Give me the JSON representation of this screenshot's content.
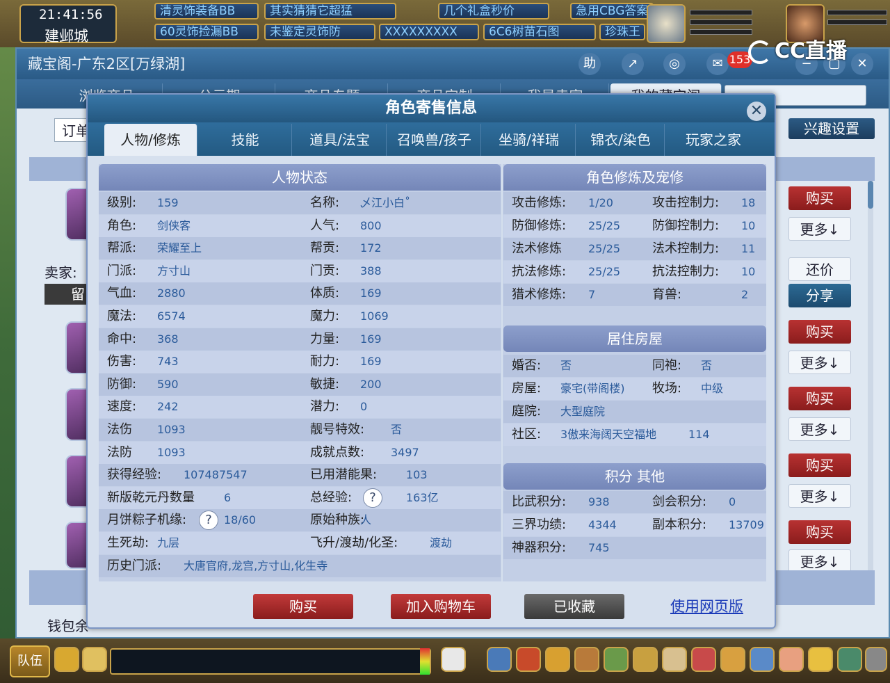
{
  "game": {
    "clock": "21:41:56",
    "city": "建邺城",
    "top_tabs": [
      "清灵饰装备BB",
      "其实猜猜它超猛",
      "几个礼盒秒价",
      "急用CBG答案",
      "60灵饰捡漏BB",
      "未鉴定灵饰防",
      "XXXXXXXXX",
      "6C6树苗石图",
      "珍珠王"
    ],
    "watermark": "CC直播",
    "team_label": "队伍"
  },
  "window": {
    "title": "藏宝阁-广东2区[万绿湖]",
    "tabs": [
      "浏览商品",
      "公示期",
      "商品专题",
      "商品定制",
      "我是卖家",
      "我的藏宝阁"
    ],
    "toolbar_help": "助",
    "message_count": "153",
    "order_label": "订单",
    "interest_label": "兴趣设置",
    "seller_label": "卖家:",
    "message_button": "留",
    "wallet_label": "钱包余",
    "right_buttons": {
      "buy": "购买",
      "more": "更多↓",
      "bargain": "还价",
      "share": "分享"
    }
  },
  "modal": {
    "title": "角色寄售信息",
    "tabs": [
      "人物/修炼",
      "技能",
      "道具/法宝",
      "召唤兽/孩子",
      "坐骑/祥瑞",
      "锦衣/染色",
      "玩家之家"
    ],
    "sections": {
      "status": "人物状态",
      "cultivation": "角色修炼及宠修",
      "house": "居住房屋",
      "score": "积分 其他"
    },
    "status_rows": [
      {
        "l1": "级别:",
        "v1": "159",
        "l2": "名称:",
        "v2": "乄江小白˚"
      },
      {
        "l1": "角色:",
        "v1": "剑侠客",
        "l2": "人气:",
        "v2": "800"
      },
      {
        "l1": "帮派:",
        "v1": "荣耀至上",
        "l2": "帮贡:",
        "v2": "172"
      },
      {
        "l1": "门派:",
        "v1": "方寸山",
        "l2": "门贡:",
        "v2": "388"
      },
      {
        "l1": "气血:",
        "v1": "2880",
        "l2": "体质:",
        "v2": "169"
      },
      {
        "l1": "魔法:",
        "v1": "6574",
        "l2": "魔力:",
        "v2": "1069"
      },
      {
        "l1": "命中:",
        "v1": "368",
        "l2": "力量:",
        "v2": "169"
      },
      {
        "l1": "伤害:",
        "v1": "743",
        "l2": "耐力:",
        "v2": "169"
      },
      {
        "l1": "防御:",
        "v1": "590",
        "l2": "敏捷:",
        "v2": "200"
      },
      {
        "l1": "速度:",
        "v1": "242",
        "l2": "潜力:",
        "v2": "0"
      },
      {
        "l1": "法伤",
        "v1": "1093",
        "l2": "靓号特效:",
        "v2": "否"
      },
      {
        "l1": "法防",
        "v1": "1093",
        "l2": "成就点数:",
        "v2": "3497"
      },
      {
        "l1": "获得经验:",
        "v1": "107487547",
        "l2": "已用潜能果:",
        "v2": "103"
      },
      {
        "l1": "新版乾元丹数量",
        "v1": "6",
        "l2": "总经验:",
        "v2": "163亿"
      },
      {
        "l1": "月饼粽子机缘:",
        "v1": "18/60",
        "l2": "原始种族:",
        "v2": "人"
      },
      {
        "l1": "生死劫:",
        "v1": "九层",
        "l2": "飞升/渡劫/化圣:",
        "v2": "渡劫"
      },
      {
        "l1": "历史门派:",
        "v1": "大唐官府,龙宫,方寸山,化生寺",
        "l2": "",
        "v2": ""
      }
    ],
    "cultivation_rows": [
      {
        "l1": "攻击修炼:",
        "v1": "1/20",
        "l2": "攻击控制力:",
        "v2": "18"
      },
      {
        "l1": "防御修炼:",
        "v1": "25/25",
        "l2": "防御控制力:",
        "v2": "10"
      },
      {
        "l1": "法术修炼",
        "v1": "25/25",
        "l2": "法术控制力:",
        "v2": "11"
      },
      {
        "l1": "抗法修炼:",
        "v1": "25/25",
        "l2": "抗法控制力:",
        "v2": "10"
      },
      {
        "l1": "猎术修炼:",
        "v1": "7",
        "l2": "育兽:",
        "v2": "2"
      }
    ],
    "house_rows": [
      {
        "l1": "婚否:",
        "v1": "否",
        "l2": "同袍:",
        "v2": "否"
      },
      {
        "l1": "房屋:",
        "v1": "豪宅(带阁楼)",
        "l2": "牧场:",
        "v2": "中级"
      },
      {
        "l1": "庭院:",
        "v1": "大型庭院",
        "l2": "",
        "v2": ""
      },
      {
        "l1": "社区:",
        "v1": "3傲来海阔天空福地",
        "l2": "",
        "v2": "114"
      }
    ],
    "score_rows": [
      {
        "l1": "比武积分:",
        "v1": "938",
        "l2": "剑会积分:",
        "v2": "0"
      },
      {
        "l1": "三界功绩:",
        "v1": "4344",
        "l2": "副本积分:",
        "v2": "13709"
      },
      {
        "l1": "神器积分:",
        "v1": "745",
        "l2": "",
        "v2": ""
      }
    ],
    "buttons": {
      "buy": "购买",
      "cart": "加入购物车",
      "favorited": "已收藏",
      "web": "使用网页版"
    }
  }
}
